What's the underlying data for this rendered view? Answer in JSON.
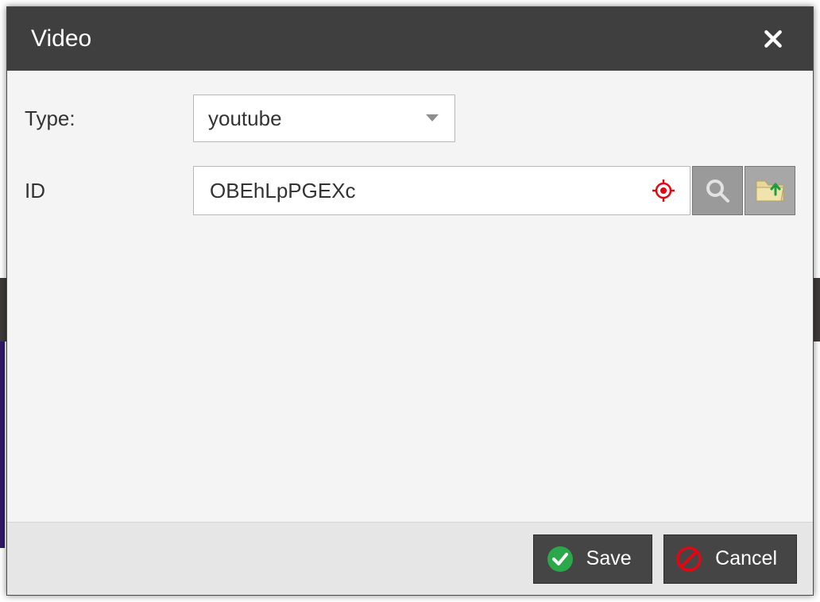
{
  "dialog": {
    "title": "Video"
  },
  "form": {
    "type_label": "Type:",
    "type_value": "youtube",
    "id_label": "ID",
    "id_value": "OBEhLpPGEXc"
  },
  "footer": {
    "save_label": "Save",
    "cancel_label": "Cancel"
  }
}
